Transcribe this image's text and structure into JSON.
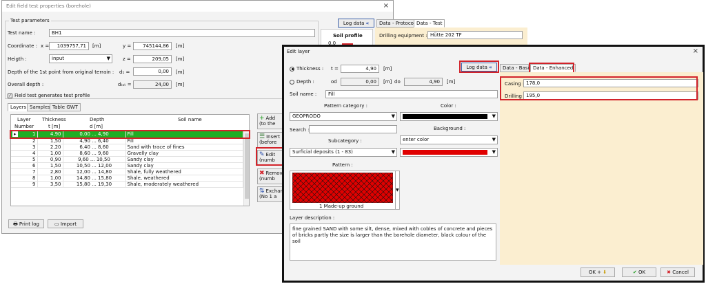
{
  "main": {
    "title": "Edit field test properties (borehole)",
    "close": "×",
    "group": "Test parameters",
    "test_name_label": "Test name :",
    "test_name": "BH1",
    "coordinate_label": "Coordinate :",
    "x_label": "x =",
    "x": "1039757,71",
    "x_unit": "[m]",
    "y_label": "y =",
    "y": "745144,86",
    "y_unit": "[m]",
    "height_label": "Heigth :",
    "height_value": "input",
    "z_label": "z =",
    "z": "209,05",
    "z_unit": "[m]",
    "depth_first_label": "Depth of the 1st point from original terrain :",
    "d1_label": "d₁ =",
    "d1": "0,00",
    "d1_unit": "[m]",
    "overall_label": "Overall depth :",
    "dtot_label": "dₜₒₜ =",
    "dtot": "24,00",
    "dtot_unit": "[m]",
    "generates_label": "Field test generates test profile",
    "tabs": [
      "Layers",
      "Samples",
      "Table GWT"
    ],
    "columns": {
      "layer": "Layer",
      "number": "Number",
      "thickness": "Thickness",
      "thickness_unit": "t [m]",
      "depth": "Depth",
      "depth_unit": "d [m]",
      "soil": "Soil name"
    },
    "rows": [
      {
        "n": "1",
        "t": "4,90",
        "d": "0,00 ... 4,90",
        "s": "Fill"
      },
      {
        "n": "2",
        "t": "1,50",
        "d": "4,90 ... 6,40",
        "s": "Fill"
      },
      {
        "n": "3",
        "t": "2,20",
        "d": "6,40 ... 8,60",
        "s": "Sand with trace of fines"
      },
      {
        "n": "4",
        "t": "1,00",
        "d": "8,60 ... 9,60",
        "s": "Gravelly clay"
      },
      {
        "n": "5",
        "t": "0,90",
        "d": "9,60 ... 10,50",
        "s": "Sandy clay"
      },
      {
        "n": "6",
        "t": "1,50",
        "d": "10,50 ... 12,00",
        "s": "Sandy clay"
      },
      {
        "n": "7",
        "t": "2,80",
        "d": "12,00 ... 14,80",
        "s": "Shale, fully weathered"
      },
      {
        "n": "8",
        "t": "1,00",
        "d": "14,80 ... 15,80",
        "s": "Shale, weathered"
      },
      {
        "n": "9",
        "t": "3,50",
        "d": "15,80 ... 19,30",
        "s": "Shale, moderately weathered"
      }
    ],
    "side_buttons": [
      {
        "line1": "Add",
        "line2": "(to the"
      },
      {
        "line1": "Insert",
        "line2": "(before"
      },
      {
        "line1": "Edit",
        "line2": "(numb"
      },
      {
        "line1": "Remov",
        "line2": "(numb"
      },
      {
        "line1": "Exchan",
        "line2": "(No 1 a"
      }
    ],
    "print_log": "Print log",
    "import": "Import",
    "log_data": "Log data",
    "tab_protocol": "Data - Protocol",
    "tab_test": "Data - Test",
    "soil_profile": "Soil profile",
    "soil_profile_val": "0,0",
    "drilling_equipment_label": "Drilling equipment :",
    "drilling_equipment": "Hütte 202 TF"
  },
  "dialog": {
    "title": "Edit layer",
    "close": "×",
    "thickness_label": "Thickness :",
    "t_label": "t =",
    "t": "4,90",
    "t_unit": "[m]",
    "depth_label": "Depth :",
    "od_label": "od",
    "od": "0,00",
    "od_unit": "[m]",
    "do_label": "do",
    "do": "4,90",
    "do_unit": "[m]",
    "soil_name_label": "Soil name :",
    "soil_name": "Fill",
    "pattern_category_label": "Pattern category :",
    "pattern_category": "GEOPRODO",
    "color_label": "Color :",
    "search_label": "Search :",
    "background_label": "Background :",
    "background_value": "enter color",
    "subcategory_label": "Subcategory :",
    "subcategory": "Surficial deposits (1 - 83)",
    "pattern_label": "Pattern :",
    "pattern_name": "1 Made-up ground",
    "layer_description_label": "Layer description :",
    "layer_description": "fine grained SAND with some silt, dense, mixed with cobles of concrete and pieces of bricks partly the size is larger than the borehole diameter, black colour of the soil",
    "log_data": "Log data",
    "tab_basic": "Data - Basic",
    "tab_enhanced": "Data - Enhanced",
    "casing_label": "Casing :",
    "casing": "178,0",
    "drilling_label": "Drilling :",
    "drilling": "195,0",
    "ok_plus": "OK +",
    "ok": "OK",
    "cancel": "Cancel"
  },
  "colors": {
    "accent_red": "#d2232a",
    "selected_row": "#1fae24",
    "pattern_red": "#e00000",
    "panel_yellow": "#fbeed0"
  }
}
